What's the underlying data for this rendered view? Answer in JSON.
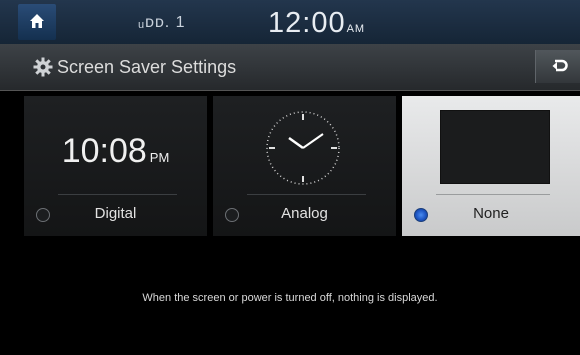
{
  "status_bar": {
    "signal_text": "ᵤᴅᴅ. 1",
    "clock_time": "12:00",
    "clock_ampm": "AM"
  },
  "header": {
    "title": "Screen Saver Settings",
    "icon": "gear-icon",
    "back_icon": "back-arrow-icon"
  },
  "tiles": [
    {
      "label": "Digital",
      "preview_time": "10:08",
      "preview_ampm": "PM",
      "selected": false
    },
    {
      "label": "Analog",
      "preview": "analog-clock",
      "selected": false
    },
    {
      "label": "None",
      "preview": "blank-screen",
      "selected": true
    }
  ],
  "note": "When the screen or power is turned off, nothing is displayed.",
  "colors": {
    "accent": "#2a6ae0",
    "selected_tile": "#d9dadb",
    "status_bar": "#1b2d42"
  }
}
